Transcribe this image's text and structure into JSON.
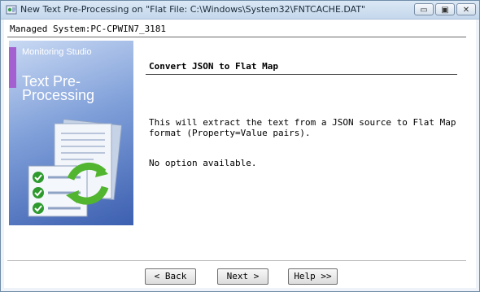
{
  "window": {
    "title": "New Text Pre-Processing on \"Flat File: C:\\Windows\\System32\\FNTCACHE.DAT\"",
    "controls": {
      "minimize": "▭",
      "maximize": "▣",
      "close": "✕"
    }
  },
  "header": {
    "managed_system": "Managed System:PC-CPWIN7_3181"
  },
  "banner": {
    "brand": "Monitoring Studio",
    "title": "Text Pre-Processing",
    "art_icon": "document-list-refresh-icon"
  },
  "content": {
    "section_title": "Convert JSON to Flat Map",
    "description": "This will extract the text from a JSON source to Flat Map format (Property=Value pairs).",
    "no_option": "No option available."
  },
  "footer": {
    "back_label": "< Back",
    "next_label": "Next >",
    "help_label": "Help >>"
  },
  "colors": {
    "banner_accent": "#a45fd1",
    "banner_blue": "#3c5fb0",
    "check_green": "#2e9a2e"
  }
}
